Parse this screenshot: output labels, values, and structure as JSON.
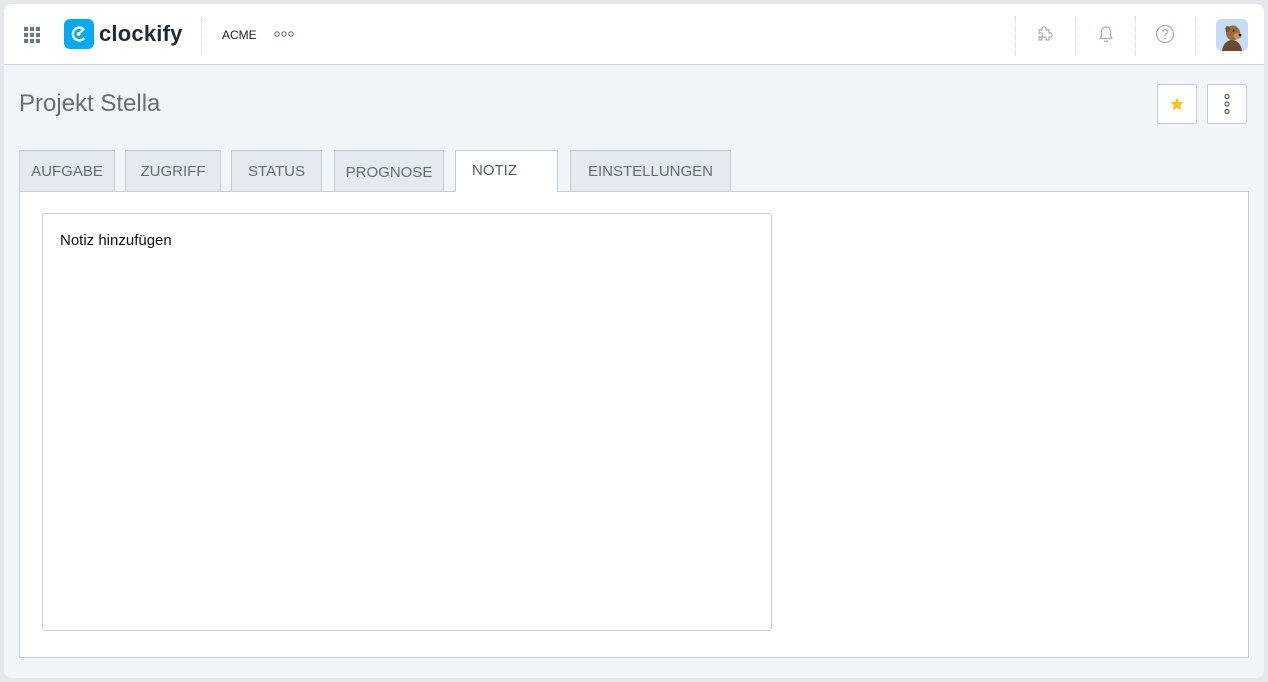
{
  "header": {
    "brand": "clockify",
    "workspace": "ACME",
    "icons": [
      "apps-grid-icon",
      "puzzle-icon",
      "bell-icon",
      "help-icon",
      "avatar"
    ]
  },
  "page": {
    "title": "Projekt Stella"
  },
  "tabs": [
    {
      "label": "AUFGABE",
      "active": false
    },
    {
      "label": "ZUGRIFF",
      "active": false
    },
    {
      "label": "STATUS",
      "active": false
    },
    {
      "label": "PROGNOSE",
      "active": false
    },
    {
      "label": "NOTIZ",
      "active": true
    },
    {
      "label": "EINSTELLUNGEN",
      "active": false
    }
  ],
  "note": {
    "placeholder": "Notiz hinzufügen"
  },
  "colors": {
    "brand": "#03a9f4",
    "star": "#f5c518"
  }
}
